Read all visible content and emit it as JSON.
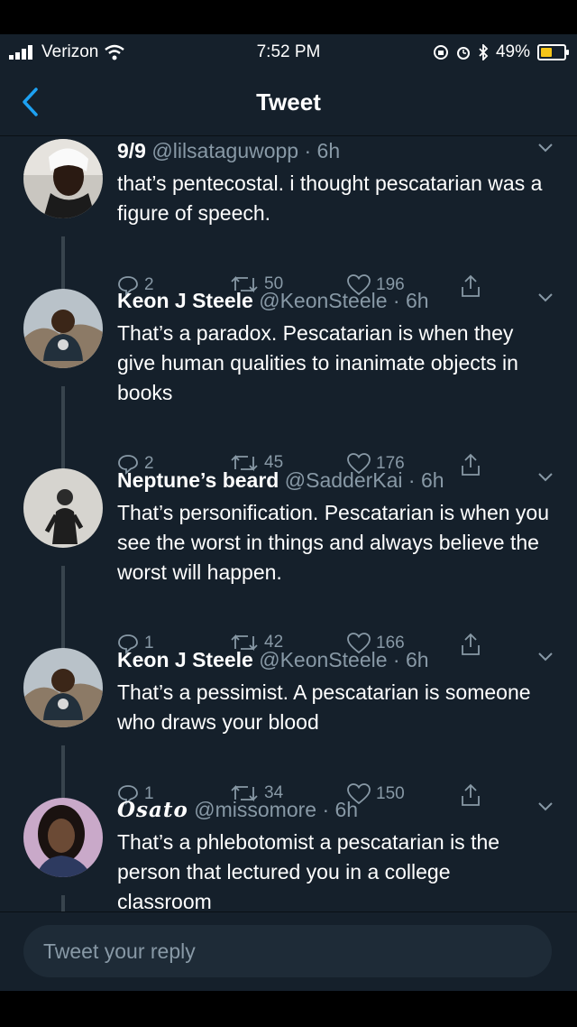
{
  "status_bar": {
    "carrier": "Verizon",
    "time": "7:52 PM",
    "battery": "49%"
  },
  "header": {
    "title": "Tweet"
  },
  "tweets": [
    {
      "name": "9/9",
      "handle": "@lilsataguwopp",
      "time": "6h",
      "text": "that’s pentecostal. i thought pescatarian was a figure of speech.",
      "replies": "2",
      "retweets": "50",
      "likes": "196"
    },
    {
      "name": "Keon J Steele",
      "handle": "@KeonSteele",
      "time": "6h",
      "text": "That’s a paradox. Pescatarian is when they give human qualities to inanimate objects in books",
      "replies": "2",
      "retweets": "45",
      "likes": "176"
    },
    {
      "name": "Neptune’s beard",
      "handle": "@SadderKai",
      "time": "6h",
      "text": "That’s personification. Pescatarian is when you see the worst in things and always believe the worst will happen.",
      "replies": "1",
      "retweets": "42",
      "likes": "166"
    },
    {
      "name": "Keon J Steele",
      "handle": "@KeonSteele",
      "time": "6h",
      "text": "That’s a pessimist. A pescatarian is someone who draws your blood",
      "replies": "1",
      "retweets": "34",
      "likes": "150"
    },
    {
      "name": "Osato",
      "handle": "@missomore",
      "time": "6h",
      "text": "That’s a phlebotomist a pescatarian is the person that lectured you in a college classroom"
    }
  ],
  "compose": {
    "placeholder": "Tweet your reply"
  }
}
